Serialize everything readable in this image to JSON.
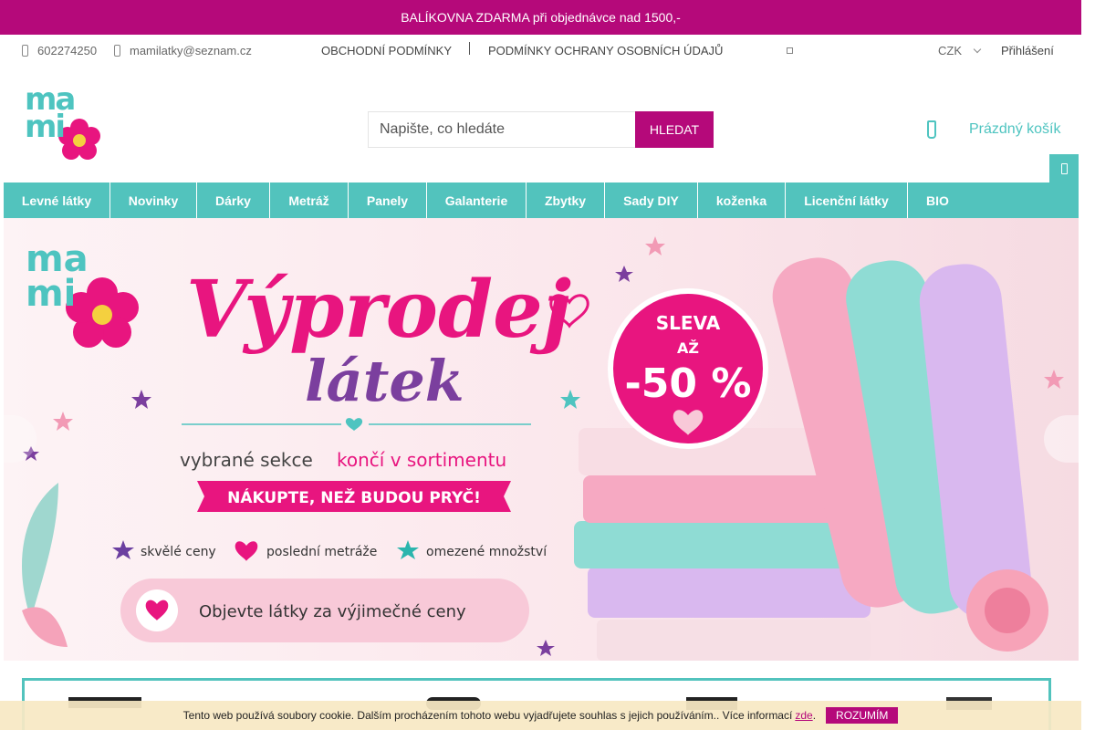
{
  "promo": {
    "text": "BALÍKOVNA ZDARMA při objednávce nad 1500,-"
  },
  "topbar": {
    "phone": "602274250",
    "email": "mamilatky@seznam.cz",
    "links": [
      "OBCHODNÍ PODMÍNKY",
      "PODMÍNKY OCHRANY OSOBNÍCH ÚDAJŮ"
    ],
    "currency": "CZK",
    "login": "Přihlášení"
  },
  "logo": {
    "line1": "ma",
    "line2": "mi"
  },
  "search": {
    "placeholder": "Napište, co hledáte",
    "button": "HLEDAT"
  },
  "cart": {
    "label": "Prázdný košík"
  },
  "nav": {
    "items": [
      "Levné látky",
      "Novinky",
      "Dárky",
      "Metráž",
      "Panely",
      "Galanterie",
      "Zbytky",
      "Sady DIY",
      "koženka",
      "Licenční látky",
      "BIO"
    ]
  },
  "hero": {
    "logo_line1": "ma",
    "logo_line2": "mi",
    "title_line1": "Výprodej",
    "title_line2": "látek",
    "subtitle_prefix": "vybrané sekce",
    "subtitle_accent": "končí v sortimentu",
    "ribbon": "NÁKUPTE, NEŽ BUDOU PRYČ!",
    "features": [
      "skvělé ceny",
      "poslední metráže",
      "omezené množství"
    ],
    "cta": "Objevte látky za výjimečné ceny",
    "badge_line1": "SLEVA",
    "badge_line2": "AŽ",
    "badge_line3": "-50 %"
  },
  "cookie": {
    "text": "Tento web používá soubory cookie. Dalším procházením tohoto webu vyjadřujete souhlas s jejich používáním.. Více informací",
    "link": "zde",
    "after": ".",
    "accept": "ROZUMÍM"
  },
  "colors": {
    "brand_magenta": "#b5097a",
    "brand_teal": "#52c3bd",
    "logo_pink": "#e8157f"
  }
}
